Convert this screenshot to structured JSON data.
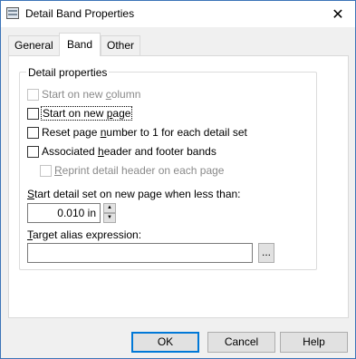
{
  "window": {
    "title": "Detail Band Properties",
    "close_glyph": "✕"
  },
  "tabs": [
    {
      "label": "General",
      "active": false
    },
    {
      "label": "Band",
      "active": true
    },
    {
      "label": "Other",
      "active": false
    }
  ],
  "group": {
    "legend": "Detail properties"
  },
  "checkboxes": {
    "start_new_column": {
      "pre": "Start on new ",
      "u": "c",
      "post": "olumn",
      "checked": false,
      "enabled": false
    },
    "start_new_page": {
      "pre": "Start on new ",
      "u": "p",
      "post": "age",
      "checked": false,
      "enabled": true
    },
    "reset_page_number": {
      "pre": "Reset page ",
      "u": "n",
      "post": "umber to 1 for each detail set",
      "checked": false,
      "enabled": true
    },
    "associated_bands": {
      "pre": "Associated ",
      "u": "h",
      "post": "eader and footer bands",
      "checked": false,
      "enabled": true
    },
    "reprint_header": {
      "pre": "",
      "u": "R",
      "post": "eprint detail header on each page",
      "checked": false,
      "enabled": false
    }
  },
  "threshold": {
    "label_u": "S",
    "label_rest": "tart detail set on new page when less than:",
    "value": "0.010 in",
    "up_glyph": "▲",
    "down_glyph": "▼"
  },
  "alias": {
    "label_u": "T",
    "label_rest": "arget alias expression:",
    "value": "",
    "browse_label": "..."
  },
  "buttons": {
    "ok": "OK",
    "cancel": "Cancel",
    "help": "Help"
  }
}
